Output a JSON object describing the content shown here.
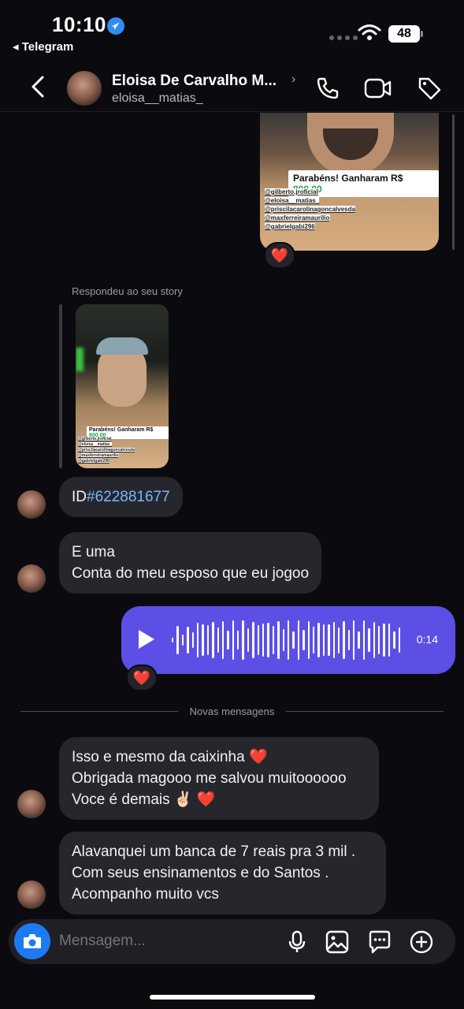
{
  "status": {
    "time": "10:10",
    "back_app": "◂ Telegram",
    "battery": "48"
  },
  "header": {
    "name": "Eloisa De Carvalho M...",
    "username": "eloisa__matias_",
    "chevron": "›"
  },
  "story_top": {
    "congrats_text": "Parabéns! Ganharam R$",
    "congrats_amount": "800,00",
    "tags": [
      "@gilberto.jroficial",
      "@eloisa__matias_",
      "@priscilacarolinagoncalvesda",
      "@maxferreiramaurilio",
      "@gabrielgabi296"
    ],
    "reaction": "❤️"
  },
  "reply": {
    "label": "Respondeu ao seu story",
    "thumb_congrats_text": "Parabéns! Ganharam R$",
    "thumb_congrats_amount": "800,00",
    "thumb_tags": [
      "@gilberto.jroficial",
      "@eloisa__matias_",
      "@priscilacarolinagoncalvesda",
      "@maxferreiramaurilio",
      "@gabrielgabi296"
    ]
  },
  "messages": {
    "m1_prefix": "ID",
    "m1_id": "#622881677",
    "m2": [
      "E uma",
      "Conta do meu esposo que eu jogoo"
    ],
    "voice_duration": "0:14",
    "voice_reaction": "❤️",
    "new_messages_label": "Novas mensagens",
    "m3": [
      "Isso e mesmo da caixinha ❤️",
      "Obrigada magooo me salvou muitoooooo",
      "Voce é demais ✌🏻 ❤️"
    ],
    "m4": [
      "Alavanquei um banca de 7 reais pra 3 mil .",
      "Com seus ensinamentos e do Santos .",
      "Acompanho muito vcs"
    ]
  },
  "composer": {
    "placeholder": "Mensagem..."
  },
  "colors": {
    "voice_bubble": "#5b4fe6",
    "camera_button": "#1d7af2",
    "incoming_bubble": "#26262d",
    "link": "#79b8ff"
  },
  "icons": [
    "location-arrow-icon",
    "wifi-icon",
    "back-chevron-icon",
    "phone-icon",
    "video-icon",
    "tag-icon",
    "play-icon",
    "camera-icon",
    "microphone-icon",
    "gallery-icon",
    "sticker-icon",
    "plus-icon"
  ]
}
